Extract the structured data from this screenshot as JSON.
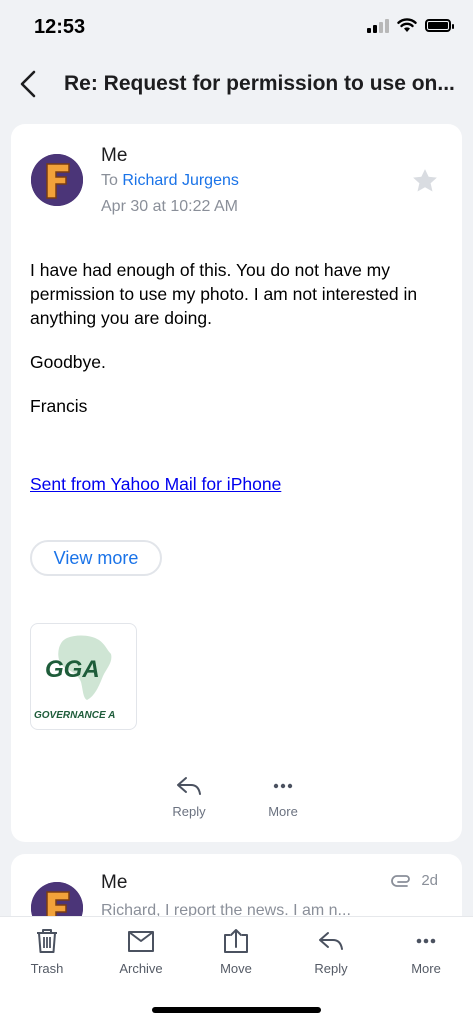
{
  "status": {
    "time": "12:53"
  },
  "nav": {
    "subject": "Re: Request for permission to use on..."
  },
  "message": {
    "sender": "Me",
    "to_prefix": "To",
    "to_name": "Richard Jurgens",
    "date": "Apr 30 at 10:22 AM",
    "body": [
      "I have had enough of this. You do not have my permission to use my photo. I am not interested in anything you are doing.",
      "Goodbye.",
      "Francis"
    ],
    "signature_link": "Sent from Yahoo Mail for iPhone",
    "view_more": "View more",
    "attachment": {
      "logo_text": "GGA",
      "caption": "GOVERNANCE A"
    },
    "actions": {
      "reply": "Reply",
      "more": "More"
    }
  },
  "next_message": {
    "sender": "Me",
    "snippet": "Richard, I report the news. I am n...",
    "age": "2d"
  },
  "toolbar": {
    "trash": "Trash",
    "archive": "Archive",
    "move": "Move",
    "reply": "Reply",
    "more": "More"
  },
  "colors": {
    "accent": "#1a73e8",
    "link": "#0000ee",
    "avatar_letter": "#f2a23a"
  }
}
